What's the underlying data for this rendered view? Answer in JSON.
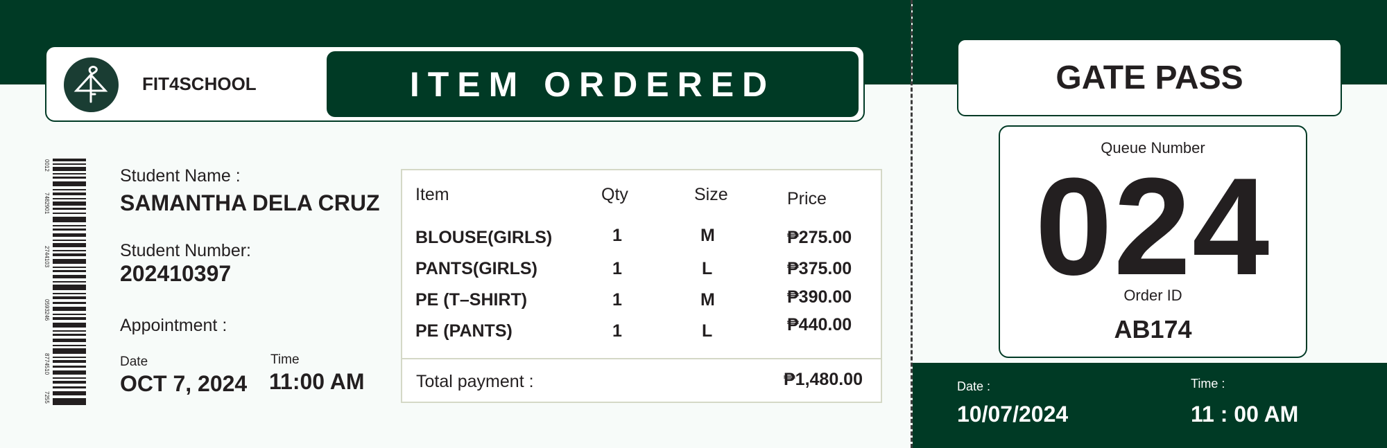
{
  "brand": {
    "name": "FIT4SCHOOL",
    "logo_icon": "hanger-icon"
  },
  "ticket": {
    "title": "ITEM ORDERED"
  },
  "barcode": {
    "numbers": [
      "0012",
      "7482901",
      "2744103",
      "0593246",
      "8774510",
      "7255"
    ]
  },
  "student": {
    "name_label": "Student Name :",
    "name": "SAMANTHA DELA CRUZ",
    "number_label": "Student Number:",
    "number": "202410397",
    "appointment_label": "Appointment :",
    "date_label": "Date",
    "date": "OCT 7, 2024",
    "time_label": "Time",
    "time": "11:00 AM"
  },
  "order_table": {
    "headers": {
      "item": "Item",
      "qty": "Qty",
      "size": "Size",
      "price": "Price"
    },
    "rows": [
      {
        "item": "BLOUSE(GIRLS)",
        "qty": "1",
        "size": "M",
        "price": "₱275.00"
      },
      {
        "item": "PANTS(GIRLS)",
        "qty": "1",
        "size": "L",
        "price": "₱375.00"
      },
      {
        "item": "PE (T–SHIRT)",
        "qty": "1",
        "size": "M",
        "price": "₱390.00"
      },
      {
        "item": "PE (PANTS)",
        "qty": "1",
        "size": "L",
        "price": "₱440.00"
      }
    ],
    "total_label": "Total payment :",
    "total": "₱1,480.00"
  },
  "gate_pass": {
    "title": "GATE PASS",
    "queue_label": "Queue Number",
    "queue_number": "024",
    "order_id_label": "Order ID",
    "order_id": "AB174",
    "date_label": "Date :",
    "date": "10/07/2024",
    "time_label": "Time :",
    "time": "11 : 00 AM"
  },
  "colors": {
    "primary": "#003a25",
    "text": "#231f20",
    "table_border": "#d4d8c6"
  }
}
